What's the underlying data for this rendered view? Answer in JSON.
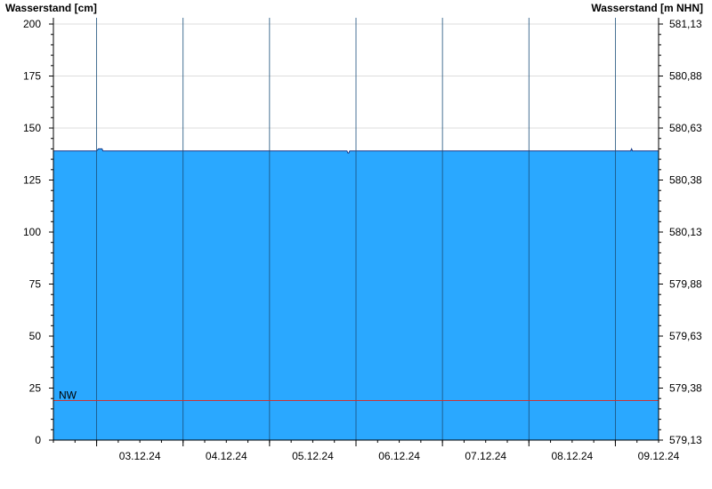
{
  "chart_data": {
    "type": "area",
    "left_axis_title": "Wasserstand [cm]",
    "right_axis_title": "Wasserstand [m NHN]",
    "y_ticks_left": [
      0,
      25,
      50,
      75,
      100,
      125,
      150,
      175,
      200
    ],
    "y_tick_labels_left": [
      "0",
      "25",
      "50",
      "75",
      "100",
      "125",
      "150",
      "175",
      "200"
    ],
    "y_tick_labels_right": [
      "579,13",
      "579,38",
      "579,63",
      "579,88",
      "580,13",
      "580,38",
      "580,63",
      "580,88",
      "581,13"
    ],
    "ylim": [
      0,
      203
    ],
    "x_start": "2024-12-02T12:00",
    "x_end": "2024-12-09T12:00",
    "day_boundaries": [
      "2024-12-03T00:00",
      "2024-12-04T00:00",
      "2024-12-05T00:00",
      "2024-12-06T00:00",
      "2024-12-07T00:00",
      "2024-12-08T00:00",
      "2024-12-09T00:00"
    ],
    "x_tick_labels": [
      "03.12.24",
      "04.12.24",
      "05.12.24",
      "06.12.24",
      "07.12.24",
      "08.12.24",
      "09.12.24"
    ],
    "series": [
      {
        "color": "#2aa8ff",
        "x": [
          "2024-12-02T12:00",
          "2024-12-03T00:00",
          "2024-12-03T00:30",
          "2024-12-03T01:30",
          "2024-12-03T01:45",
          "2024-12-04T00:00",
          "2024-12-05T00:00",
          "2024-12-05T21:30",
          "2024-12-05T21:45",
          "2024-12-05T22:00",
          "2024-12-05T22:15",
          "2024-12-06T00:00",
          "2024-12-07T00:00",
          "2024-12-08T00:00",
          "2024-12-09T00:00",
          "2024-12-09T04:15",
          "2024-12-09T04:30",
          "2024-12-09T04:45",
          "2024-12-09T12:00"
        ],
        "values": [
          139,
          139,
          140,
          140,
          139,
          139,
          139,
          139,
          138,
          138,
          139,
          139,
          139,
          139,
          139,
          139,
          140,
          139,
          139
        ]
      }
    ],
    "reference_lines": [
      {
        "label": "NW",
        "value": 19,
        "color": "#cc3333"
      }
    ],
    "grid": true
  }
}
